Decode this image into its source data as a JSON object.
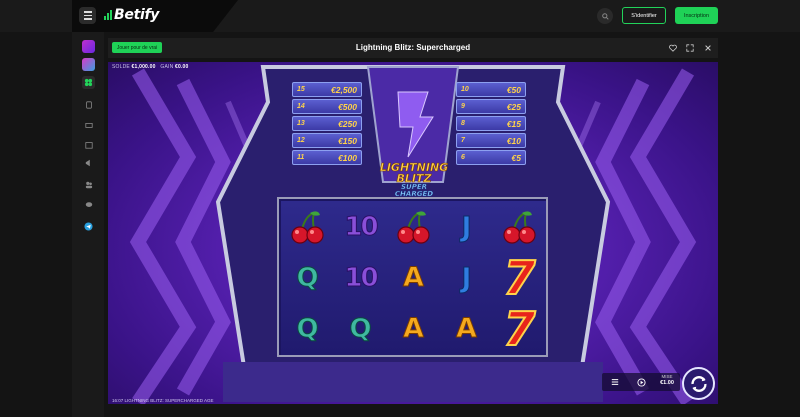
{
  "header": {
    "logo_text": "Betify",
    "login_label": "S'identifier",
    "signup_label": "Inscription"
  },
  "game": {
    "real_play_label": "Jouer pour de vrai",
    "title": "Lightning Blitz: Supercharged",
    "balance_label": "SOLDE",
    "balance_value": "€1,000.00",
    "win_label": "GAIN",
    "win_value": "€0.00",
    "bet_label": "MISE",
    "bet_value": "€1.00",
    "footer_text": "16:07   LIGHTNING BLITZ: SUPERCHARGED   AGE",
    "logo_line1": "LIGHTNING",
    "logo_line2": "BLITZ",
    "logo_line3": "SUPER",
    "logo_line4": "CHARGED"
  },
  "jackpots_left": [
    {
      "level": "15",
      "amount": "€2,500"
    },
    {
      "level": "14",
      "amount": "€500"
    },
    {
      "level": "13",
      "amount": "€250"
    },
    {
      "level": "12",
      "amount": "€150"
    },
    {
      "level": "11",
      "amount": "€100"
    }
  ],
  "jackpots_right": [
    {
      "level": "10",
      "amount": "€50"
    },
    {
      "level": "9",
      "amount": "€25"
    },
    {
      "level": "8",
      "amount": "€15"
    },
    {
      "level": "7",
      "amount": "€10"
    },
    {
      "level": "6",
      "amount": "€5"
    }
  ],
  "reels": [
    [
      "cherry",
      "Q",
      "Q"
    ],
    [
      "10",
      "10",
      "Q"
    ],
    [
      "cherry",
      "A",
      "A"
    ],
    [
      "J",
      "J",
      "A"
    ],
    [
      "cherry",
      "7",
      "7"
    ]
  ],
  "sidebar_icons": [
    "casino-icon",
    "live-casino-icon",
    "slots-icon",
    "sports-icon",
    "promotions-icon",
    "shop-icon",
    "megaphone-icon",
    "community-icon",
    "chat-icon",
    "telegram-icon"
  ],
  "colors": {
    "accent": "#1fd257",
    "background": "#141414",
    "game_purple": "#5620b0",
    "jackpot_gold": "#ffd34a"
  }
}
